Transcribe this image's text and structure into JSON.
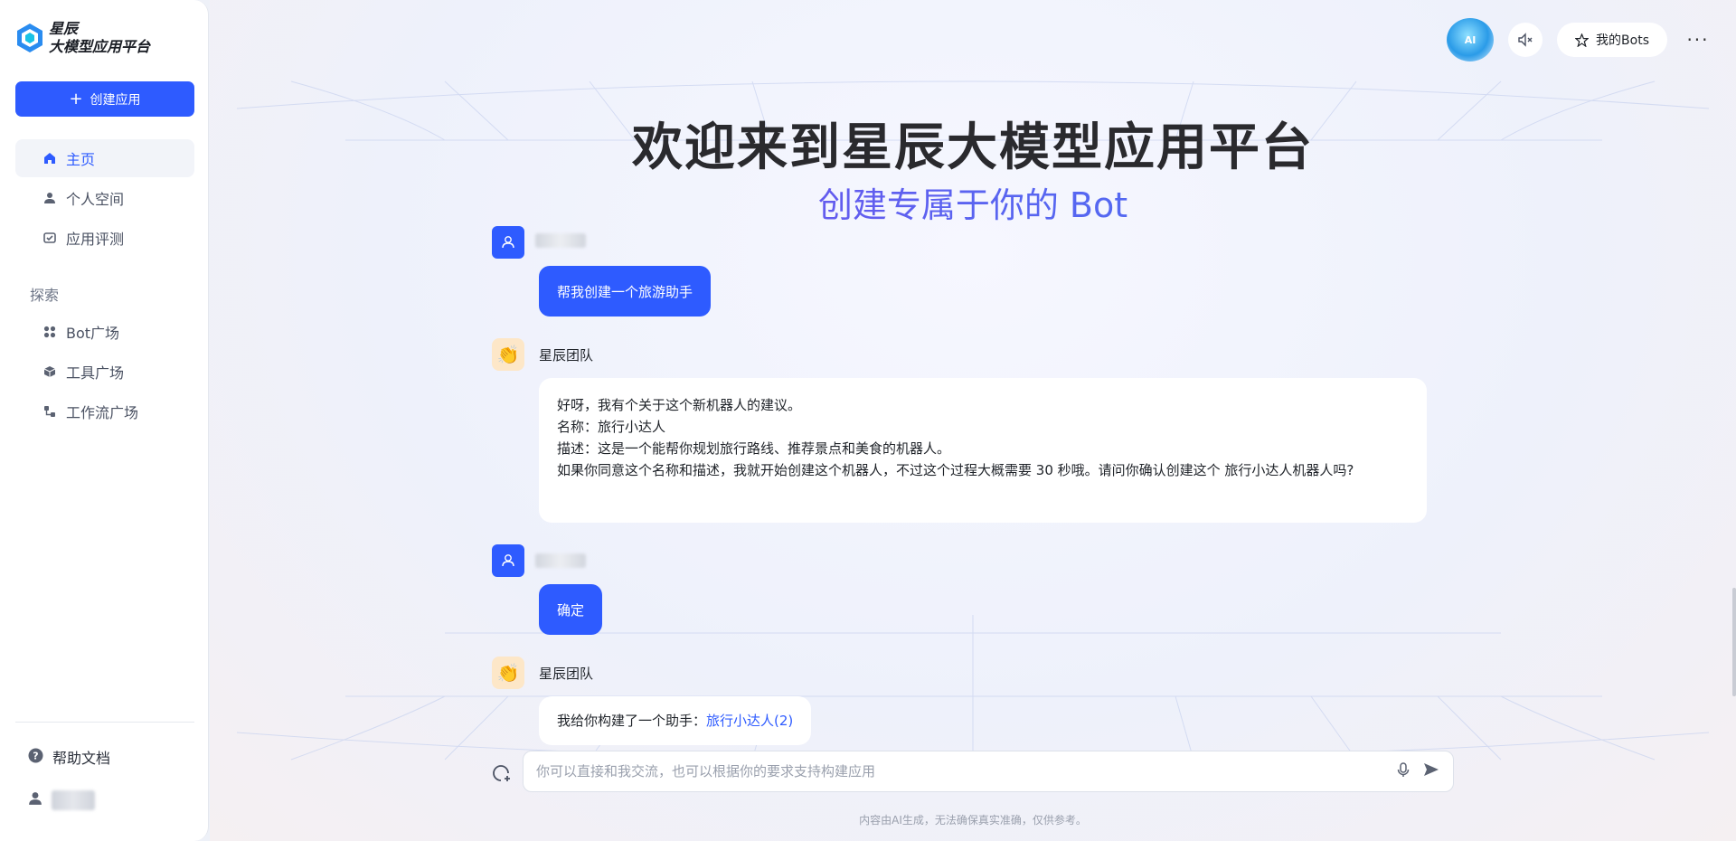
{
  "sidebar": {
    "logo_line1": "星辰",
    "logo_line2": "大模型应用平台",
    "create_label": "创建应用",
    "nav": [
      {
        "label": "主页"
      },
      {
        "label": "个人空间"
      },
      {
        "label": "应用评测"
      }
    ],
    "explore_label": "探索",
    "explore": [
      {
        "label": "Bot广场"
      },
      {
        "label": "工具广场"
      },
      {
        "label": "工作流广场"
      }
    ],
    "help_label": "帮助文档"
  },
  "topbar": {
    "ai_badge": "AI",
    "my_bots_label": "我的Bots",
    "more_label": "···"
  },
  "hero": {
    "title": "欢迎来到星辰大模型应用平台",
    "subtitle": "创建专属于你的 Bot"
  },
  "chat": {
    "messages": [
      {
        "role": "user",
        "text": "帮我创建一个旅游助手"
      },
      {
        "role": "bot",
        "name": "星辰团队",
        "lines": [
          "好呀，我有个关于这个新机器人的建议。",
          "名称：旅行小达人",
          "描述：这是一个能帮你规划旅行路线、推荐景点和美食的机器人。",
          "如果你同意这个名称和描述，我就开始创建这个机器人，不过这个过程大概需要 30 秒哦。请问你确认创建这个 旅行小达人机器人吗?"
        ]
      },
      {
        "role": "user",
        "text": "确定"
      },
      {
        "role": "bot",
        "name": "星辰团队",
        "prefix": "我给你构建了一个助手：",
        "link": "旅行小达人(2)"
      }
    ]
  },
  "composer": {
    "placeholder": "你可以直接和我交流，也可以根据你的要求支持构建应用"
  },
  "disclaimer": "内容由AI生成，无法确保真实准确，仅供参考。",
  "colors": {
    "primary": "#2e5bff",
    "sidebar_bg": "#ffffff",
    "active_bg": "#f2f4f9"
  }
}
